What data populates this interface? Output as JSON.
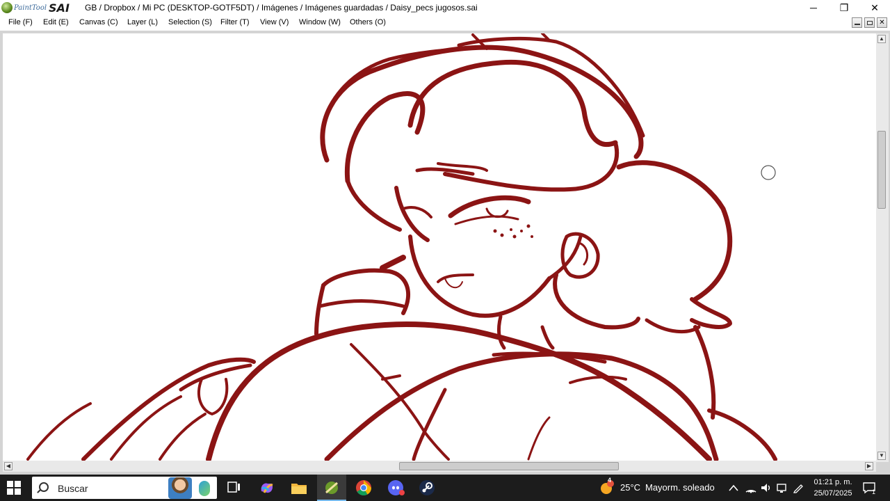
{
  "app": {
    "logo_small": "PaintTool",
    "logo_big": "SAI",
    "title": "GB / Dropbox / Mi PC (DESKTOP-GOTF5DT) / Imágenes / Imágenes guardadas / Daisy_pecs jugosos.sai"
  },
  "window_controls": {
    "minimize": "─",
    "restore": "❐",
    "close": "✕"
  },
  "menu": [
    {
      "label": "File (F)"
    },
    {
      "label": "Edit (E)"
    },
    {
      "label": "Canvas (C)"
    },
    {
      "label": "Layer (L)"
    },
    {
      "label": "Selection (S)"
    },
    {
      "label": "Filter (T)"
    },
    {
      "label": "View (V)"
    },
    {
      "label": "Window (W)"
    },
    {
      "label": "Others (O)"
    }
  ],
  "canvas": {
    "stroke_color": "#8b1414",
    "brush_cursor": "circle-cursor"
  },
  "scroll": {
    "vertical_position": 0.25,
    "horizontal_position": 0.46
  },
  "taskbar": {
    "search_placeholder": "Buscar",
    "weather_temp": "25°C",
    "weather_desc": "Mayorm. soleado",
    "weather_badge": "4",
    "time": "01:21 p. m.",
    "date": "25/07/2025",
    "notification_count": "1",
    "apps": [
      {
        "name": "task-view-icon"
      },
      {
        "name": "copilot-icon"
      },
      {
        "name": "file-explorer-icon"
      },
      {
        "name": "painttool-sai-icon"
      },
      {
        "name": "chrome-icon"
      },
      {
        "name": "discord-icon"
      },
      {
        "name": "steam-icon"
      }
    ]
  },
  "colors": {
    "ink": "#8b1414",
    "taskbar": "#1c1c1c",
    "active_indicator": "#76b9ed"
  }
}
